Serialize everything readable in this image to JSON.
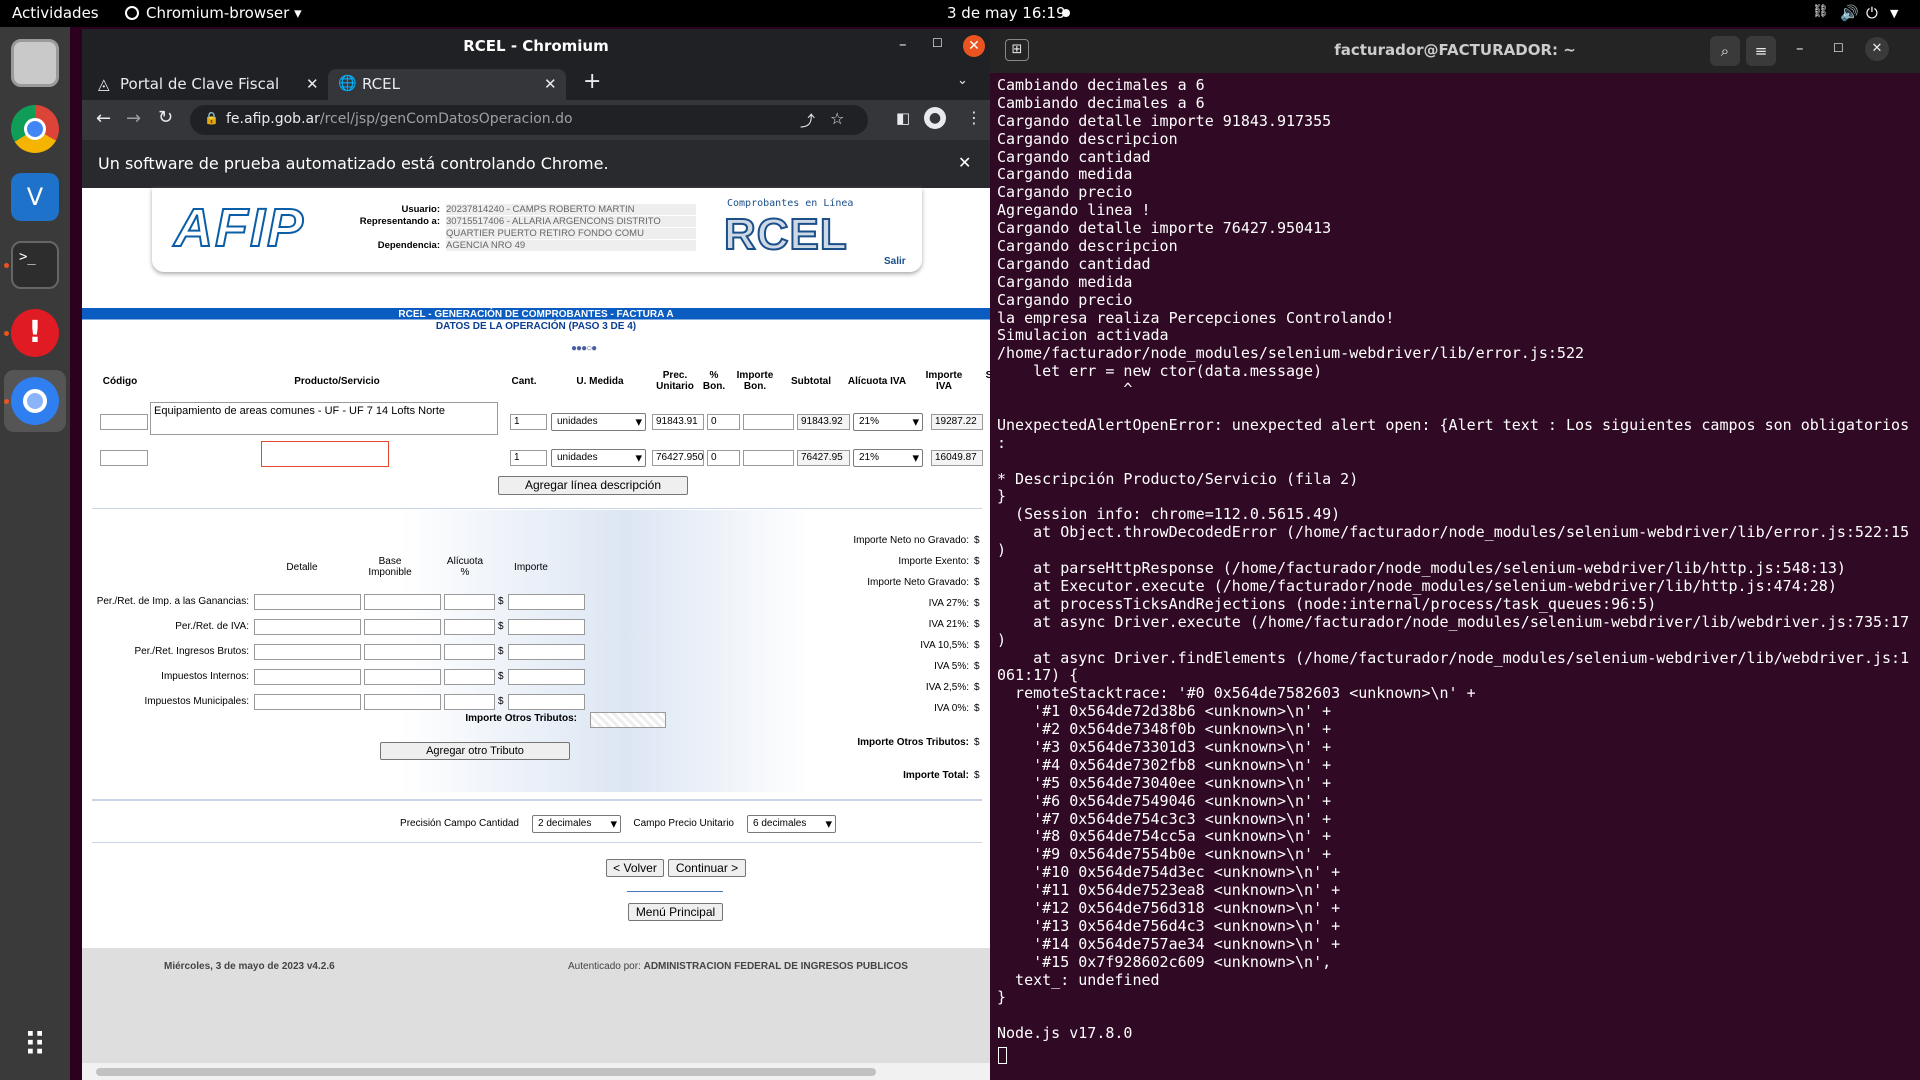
{
  "topbar": {
    "activities": "Actividades",
    "app": "Chromium-browser",
    "clock": "3 de may  16:19"
  },
  "dock": {
    "items": [
      "files-icon",
      "chrome-icon",
      "vscode-icon",
      "terminal-icon",
      "update-icon",
      "chromium-icon",
      "apps-grid-icon"
    ]
  },
  "chrome": {
    "title": "RCEL - Chromium",
    "tabs": [
      {
        "label": "Portal de Clave Fiscal"
      },
      {
        "label": "RCEL"
      }
    ],
    "url_host": "fe.afip.gob.ar",
    "url_path": "/rcel/jsp/genComDatosOperacion.do",
    "infobar": "Un software de prueba automatizado está controlando Chrome."
  },
  "afip": {
    "logo": "AFIP",
    "user_label": "Usuario:",
    "user_value": "20237814240 - CAMPS ROBERTO MARTIN",
    "rep_label": "Representando a:",
    "rep_value1": "30715517406 - ALLARIA ARGENCONS DISTRITO",
    "rep_value2": "QUARTIER PUERTO RETIRO FONDO COMU",
    "dep_label": "Dependencia:",
    "dep_value": "AGENCIA NRO 49",
    "rcel_small": "Comprobantes en Línea",
    "rcel_logo": "RCEL",
    "salir": "Salir",
    "banner1": "RCEL - GENERACIÓN DE COMPROBANTES - FACTURA A",
    "banner2": "DATOS DE LA OPERACIÓN (PASO 3 DE 4)"
  },
  "items": {
    "headers": {
      "codigo": "Código",
      "producto": "Producto/Servicio",
      "cant": "Cant.",
      "medida": "U. Medida",
      "prec1": "Prec.",
      "prec2": "Unitario",
      "bon1": "%",
      "bon2": "Bon.",
      "imp1": "Importe",
      "imp2": "Bon.",
      "subtotal": "Subtotal",
      "alic": "Alícuota IVA",
      "iva1": "Importe",
      "iva2": "IVA",
      "s": "S"
    },
    "rows": [
      {
        "desc": "Equipamiento de areas comunes - UF - UF 7 14 Lofts Norte",
        "cant": "1",
        "medida": "unidades",
        "precio": "91843.91",
        "bon": "0",
        "subtotal": "91843.92",
        "alic": "21%",
        "iva": "19287.22"
      },
      {
        "desc": "",
        "cant": "1",
        "medida": "unidades",
        "precio": "76427.950",
        "bon": "0",
        "subtotal": "76427.95",
        "alic": "21%",
        "iva": "16049.87"
      }
    ],
    "add_line": "Agregar línea descripción"
  },
  "tributos": {
    "h_detalle": "Detalle",
    "h_base1": "Base",
    "h_base2": "Imponible",
    "h_alic1": "Alícuota",
    "h_alic2": "%",
    "h_importe": "Importe",
    "rows": [
      "Per./Ret. de Imp. a las Ganancias:",
      "Per./Ret. de IVA:",
      "Per./Ret. Ingresos Brutos:",
      "Impuestos Internos:",
      "Impuestos Municipales:"
    ],
    "otros": "Importe Otros Tributos:",
    "add": "Agregar otro Tributo",
    "dollar": "$"
  },
  "totales": [
    "Importe Neto no Gravado:",
    "Importe Exento:",
    "Importe Neto Gravado:",
    "IVA 27%:",
    "IVA 21%:",
    "IVA 10,5%:",
    "IVA 5%:",
    "IVA 2,5%:",
    "IVA 0%:"
  ],
  "totales_otros": "Importe Otros Tributos:",
  "total": "Importe Total:",
  "precision": {
    "cant_label": "Precisión Campo Cantidad",
    "cant_value": "2 decimales",
    "precio_label": "Campo Precio Unitario",
    "precio_value": "6 decimales"
  },
  "nav": {
    "volver": "< Volver",
    "continuar": "Continuar >",
    "menu": "Menú Principal"
  },
  "footer": {
    "left": "Miércoles, 3 de mayo de 2023 v4.2.6",
    "auth_label": "Autenticado por:",
    "auth_value": "ADMINISTRACION FEDERAL DE INGRESOS PUBLICOS"
  },
  "terminal": {
    "title": "facturador@FACTURADOR: ~",
    "lines": [
      "Cambiando decimales a 6",
      "Cambiando decimales a 6",
      "Cargando detalle importe 91843.917355",
      "Cargando descripcion",
      "Cargando cantidad",
      "Cargando medida",
      "Cargando precio",
      "Agregando linea !",
      "Cargando detalle importe 76427.950413",
      "Cargando descripcion",
      "Cargando cantidad",
      "Cargando medida",
      "Cargando precio",
      "la empresa realiza Percepciones Controlando!",
      "Simulacion activada",
      "/home/facturador/node_modules/selenium-webdriver/lib/error.js:522",
      "    let err = new ctor(data.message)",
      "              ^",
      "",
      "UnexpectedAlertOpenError: unexpected alert open: {Alert text : Los siguientes campos son obligatorios",
      ":",
      "",
      "* Descripción Producto/Servicio (fila 2)",
      "}",
      "  (Session info: chrome=112.0.5615.49)",
      "    at Object.throwDecodedError (/home/facturador/node_modules/selenium-webdriver/lib/error.js:522:15",
      ")",
      "    at parseHttpResponse (/home/facturador/node_modules/selenium-webdriver/lib/http.js:548:13)",
      "    at Executor.execute (/home/facturador/node_modules/selenium-webdriver/lib/http.js:474:28)",
      "    at processTicksAndRejections (node:internal/process/task_queues:96:5)",
      "    at async Driver.execute (/home/facturador/node_modules/selenium-webdriver/lib/webdriver.js:735:17",
      ")",
      "    at async Driver.findElements (/home/facturador/node_modules/selenium-webdriver/lib/webdriver.js:1",
      "061:17) {",
      "  remoteStacktrace: '#0 0x564de7582603 <unknown>\\n' +",
      "    '#1 0x564de72d38b6 <unknown>\\n' +",
      "    '#2 0x564de7348f0b <unknown>\\n' +",
      "    '#3 0x564de73301d3 <unknown>\\n' +",
      "    '#4 0x564de7302fb8 <unknown>\\n' +",
      "    '#5 0x564de73040ee <unknown>\\n' +",
      "    '#6 0x564de7549046 <unknown>\\n' +",
      "    '#7 0x564de754c3c3 <unknown>\\n' +",
      "    '#8 0x564de754cc5a <unknown>\\n' +",
      "    '#9 0x564de7554b0e <unknown>\\n' +",
      "    '#10 0x564de754d3ec <unknown>\\n' +",
      "    '#11 0x564de7523ea8 <unknown>\\n' +",
      "    '#12 0x564de756d318 <unknown>\\n' +",
      "    '#13 0x564de756d4c3 <unknown>\\n' +",
      "    '#14 0x564de757ae34 <unknown>\\n' +",
      "    '#15 0x7f928602c609 <unknown>\\n',",
      "  text_: undefined",
      "}",
      "",
      "Node.js v17.8.0"
    ]
  }
}
